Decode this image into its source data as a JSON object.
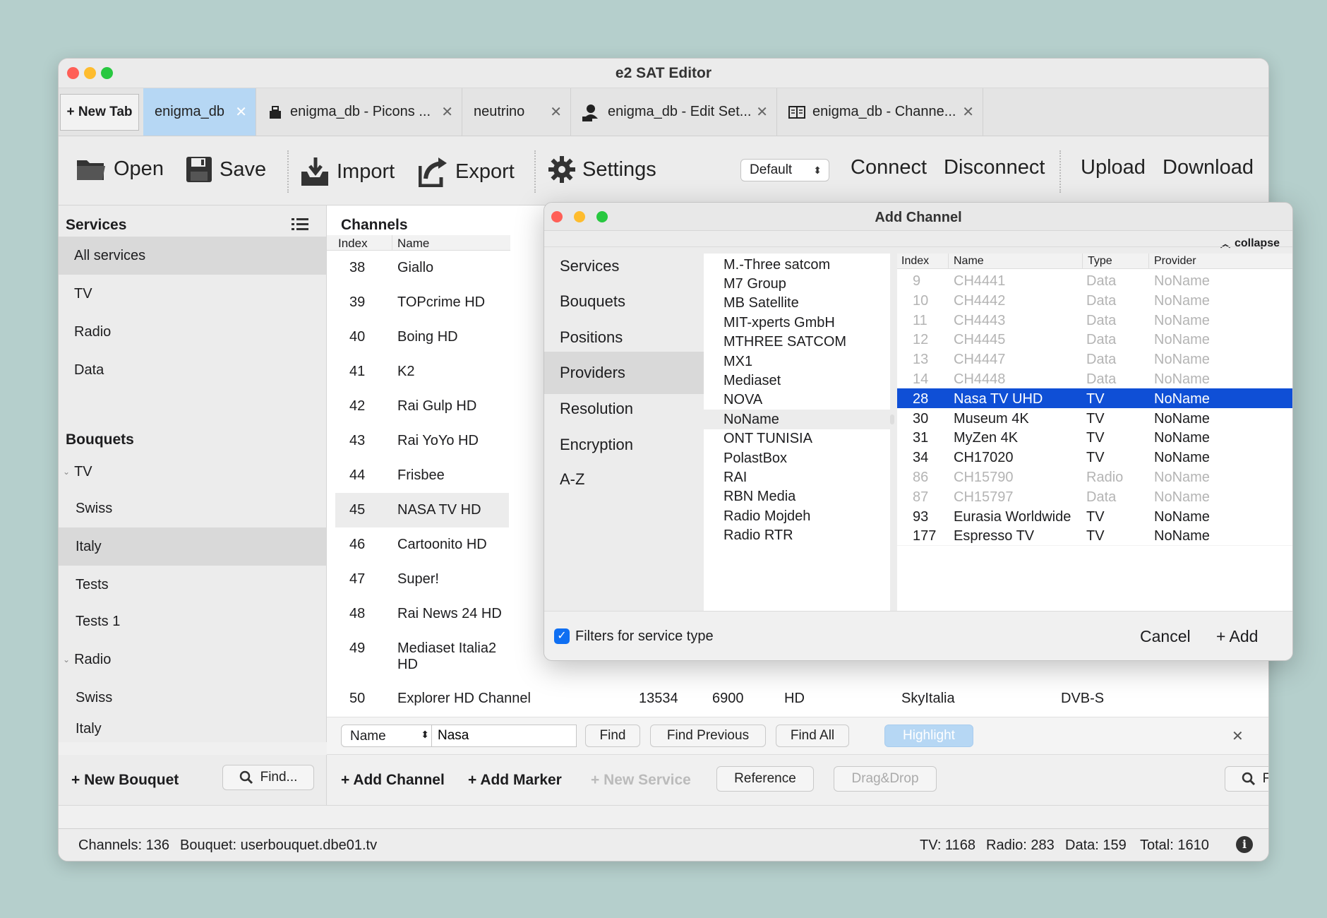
{
  "window": {
    "title": "e2 SAT Editor"
  },
  "tabs": {
    "new_tab": "+ New Tab",
    "items": [
      {
        "label": "enigma_db",
        "icon": "none"
      },
      {
        "label": "enigma_db - Picons ...",
        "icon": "picon-icon"
      },
      {
        "label": "neutrino",
        "icon": "none"
      },
      {
        "label": "enigma_db - Edit Set...",
        "icon": "xml-user-icon"
      },
      {
        "label": "enigma_db - Channe...",
        "icon": "book-icon"
      }
    ],
    "close": "✕"
  },
  "toolbar": {
    "open": "Open",
    "save": "Save",
    "import": "Import",
    "export": "Export",
    "settings": "Settings",
    "profile": "Default",
    "connect": "Connect",
    "disconnect": "Disconnect",
    "upload": "Upload",
    "download": "Download"
  },
  "services": {
    "title": "Services",
    "items": [
      "All services",
      "TV",
      "Radio",
      "Data"
    ]
  },
  "bouquets": {
    "title": "Bouquets",
    "tv_group": "TV",
    "tv_items": [
      "Swiss",
      "Italy",
      "Tests",
      "Tests 1"
    ],
    "radio_group": "Radio",
    "radio_items": [
      "Swiss",
      "Italy"
    ],
    "new_bouquet": "+ New Bouquet",
    "find": "Find..."
  },
  "channels": {
    "title": "Channels",
    "col_index": "Index",
    "col_name": "Name",
    "rows": [
      [
        "38",
        "Giallo"
      ],
      [
        "39",
        "TOPcrime HD"
      ],
      [
        "40",
        "Boing HD"
      ],
      [
        "41",
        "K2"
      ],
      [
        "42",
        "Rai Gulp HD"
      ],
      [
        "43",
        "Rai YoYo HD"
      ],
      [
        "44",
        "Frisbee"
      ],
      [
        "45",
        "NASA TV HD"
      ],
      [
        "46",
        "Cartoonito HD"
      ],
      [
        "47",
        "Super!"
      ],
      [
        "48",
        "Rai News 24 HD"
      ],
      [
        "49",
        "Mediaset Italia2 HD"
      ]
    ],
    "last_row": {
      "index": "50",
      "name": "Explorer HD Channel",
      "tsid": "13534",
      "ssid": "6900",
      "type": "HD",
      "provider": "SkyItalia",
      "system": "DVB-S"
    }
  },
  "findbar": {
    "field": "Name",
    "value": "Nasa",
    "find": "Find",
    "find_previous": "Find Previous",
    "find_all": "Find All",
    "highlight": "Highlight",
    "close": "✕"
  },
  "bottom_actions": {
    "add_channel": "+ Add Channel",
    "add_marker": "+ Add Marker",
    "new_service": "+ New Service",
    "reference": "Reference",
    "dragdrop": "Drag&Drop",
    "find": "Find..."
  },
  "status": {
    "channels": "Channels: 136",
    "bouquet": "Bouquet: userbouquet.dbe01.tv",
    "tv": "TV: 1168",
    "radio": "Radio: 283",
    "data": "Data: 159",
    "total": "Total: 1610"
  },
  "dialog": {
    "title": "Add Channel",
    "collapse": "collapse",
    "categories": [
      "Services",
      "Bouquets",
      "Positions",
      "Providers",
      "Resolution",
      "Encryption",
      "A-Z"
    ],
    "selected_category": 3,
    "providers": [
      "M.-Three satcom",
      "M7 Group",
      "MB Satellite",
      "MIT-xperts GmbH",
      "MTHREE SATCOM",
      "MX1",
      "Mediaset",
      "NOVA",
      "NoName",
      "ONT TUNISIA",
      "PolastBox",
      "RAI",
      "RBN Media",
      "Radio Mojdeh",
      "Radio RTR"
    ],
    "selected_provider": 8,
    "table": {
      "headers": [
        "Index",
        "Name",
        "Type",
        "Provider"
      ],
      "rows": [
        {
          "index": "9",
          "name": "CH4441",
          "type": "Data",
          "provider": "NoName",
          "state": "off"
        },
        {
          "index": "10",
          "name": "CH4442",
          "type": "Data",
          "provider": "NoName",
          "state": "off"
        },
        {
          "index": "11",
          "name": "CH4443",
          "type": "Data",
          "provider": "NoName",
          "state": "off"
        },
        {
          "index": "12",
          "name": "CH4445",
          "type": "Data",
          "provider": "NoName",
          "state": "off"
        },
        {
          "index": "13",
          "name": "CH4447",
          "type": "Data",
          "provider": "NoName",
          "state": "off"
        },
        {
          "index": "14",
          "name": "CH4448",
          "type": "Data",
          "provider": "NoName",
          "state": "off"
        },
        {
          "index": "28",
          "name": "Nasa TV UHD",
          "type": "TV",
          "provider": "NoName",
          "state": "sel"
        },
        {
          "index": "30",
          "name": "Museum 4K",
          "type": "TV",
          "provider": "NoName",
          "state": "on"
        },
        {
          "index": "31",
          "name": "MyZen 4K",
          "type": "TV",
          "provider": "NoName",
          "state": "on"
        },
        {
          "index": "34",
          "name": "CH17020",
          "type": "TV",
          "provider": "NoName",
          "state": "on"
        },
        {
          "index": "86",
          "name": "CH15790",
          "type": "Radio",
          "provider": "NoName",
          "state": "off"
        },
        {
          "index": "87",
          "name": "CH15797",
          "type": "Data",
          "provider": "NoName",
          "state": "off"
        },
        {
          "index": "93",
          "name": "Eurasia Worldwide",
          "type": "TV",
          "provider": "NoName",
          "state": "on"
        },
        {
          "index": "177",
          "name": "Espresso TV",
          "type": "TV",
          "provider": "NoName",
          "state": "on"
        }
      ]
    },
    "filter_label": "Filters for service type",
    "cancel": "Cancel",
    "add": "+ Add"
  },
  "colors": {
    "accent": "#0f4fd6",
    "active_tab": "#b6d7f4",
    "close_red": "#ff5f57",
    "min_yellow": "#febc2e",
    "max_green": "#28c840"
  }
}
